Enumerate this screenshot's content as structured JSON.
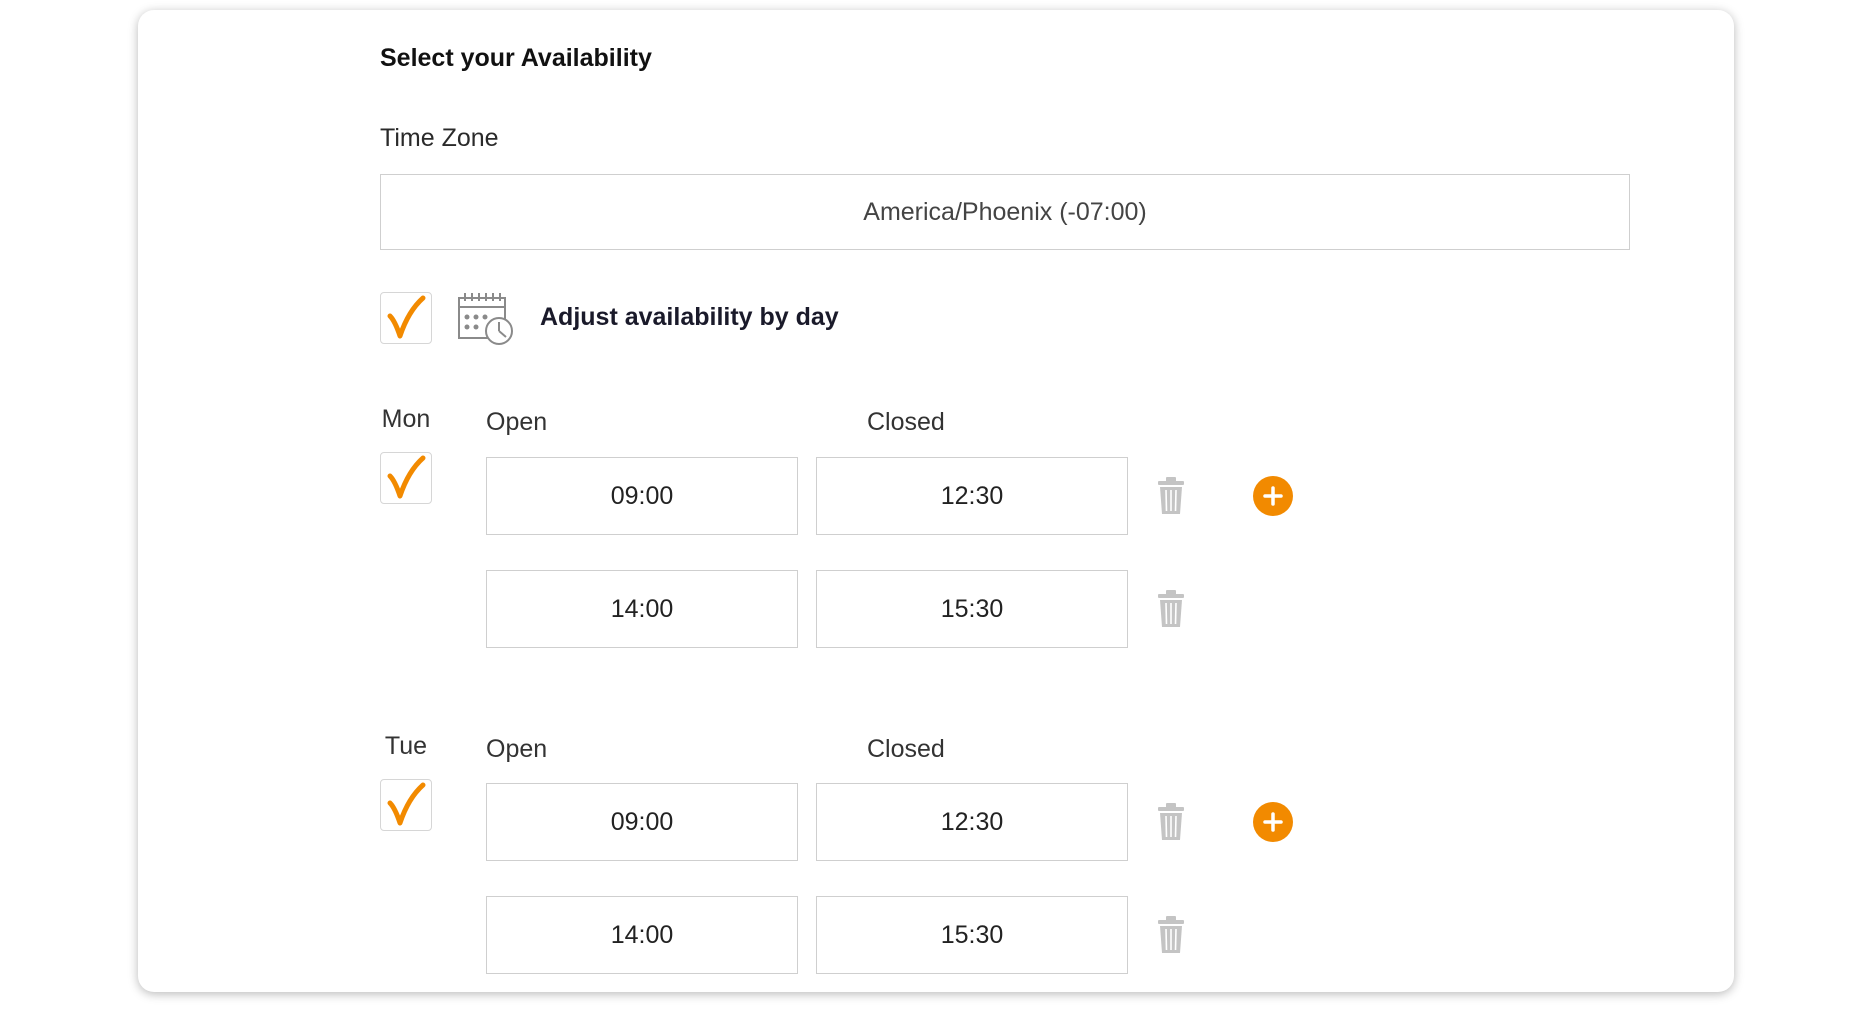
{
  "header": {
    "title": "Select your Availability"
  },
  "timezone": {
    "label": "Time Zone",
    "value": "America/Phoenix (-07:00)"
  },
  "adjust_by_day": {
    "checked": true,
    "label": "Adjust availability by day",
    "icon": "calendar-clock-icon"
  },
  "days": [
    {
      "day": "Mon",
      "checked": true,
      "open_label": "Open",
      "closed_label": "Closed",
      "slots": [
        {
          "open": "09:00",
          "closed": "12:30"
        },
        {
          "open": "14:00",
          "closed": "15:30"
        }
      ]
    },
    {
      "day": "Tue",
      "checked": true,
      "open_label": "Open",
      "closed_label": "Closed",
      "slots": [
        {
          "open": "09:00",
          "closed": "12:30"
        },
        {
          "open": "14:00",
          "closed": "15:30"
        }
      ]
    }
  ],
  "colors": {
    "accent": "#f28a00",
    "border": "#cfcfcf",
    "icon_gray": "#c4c4c4"
  }
}
